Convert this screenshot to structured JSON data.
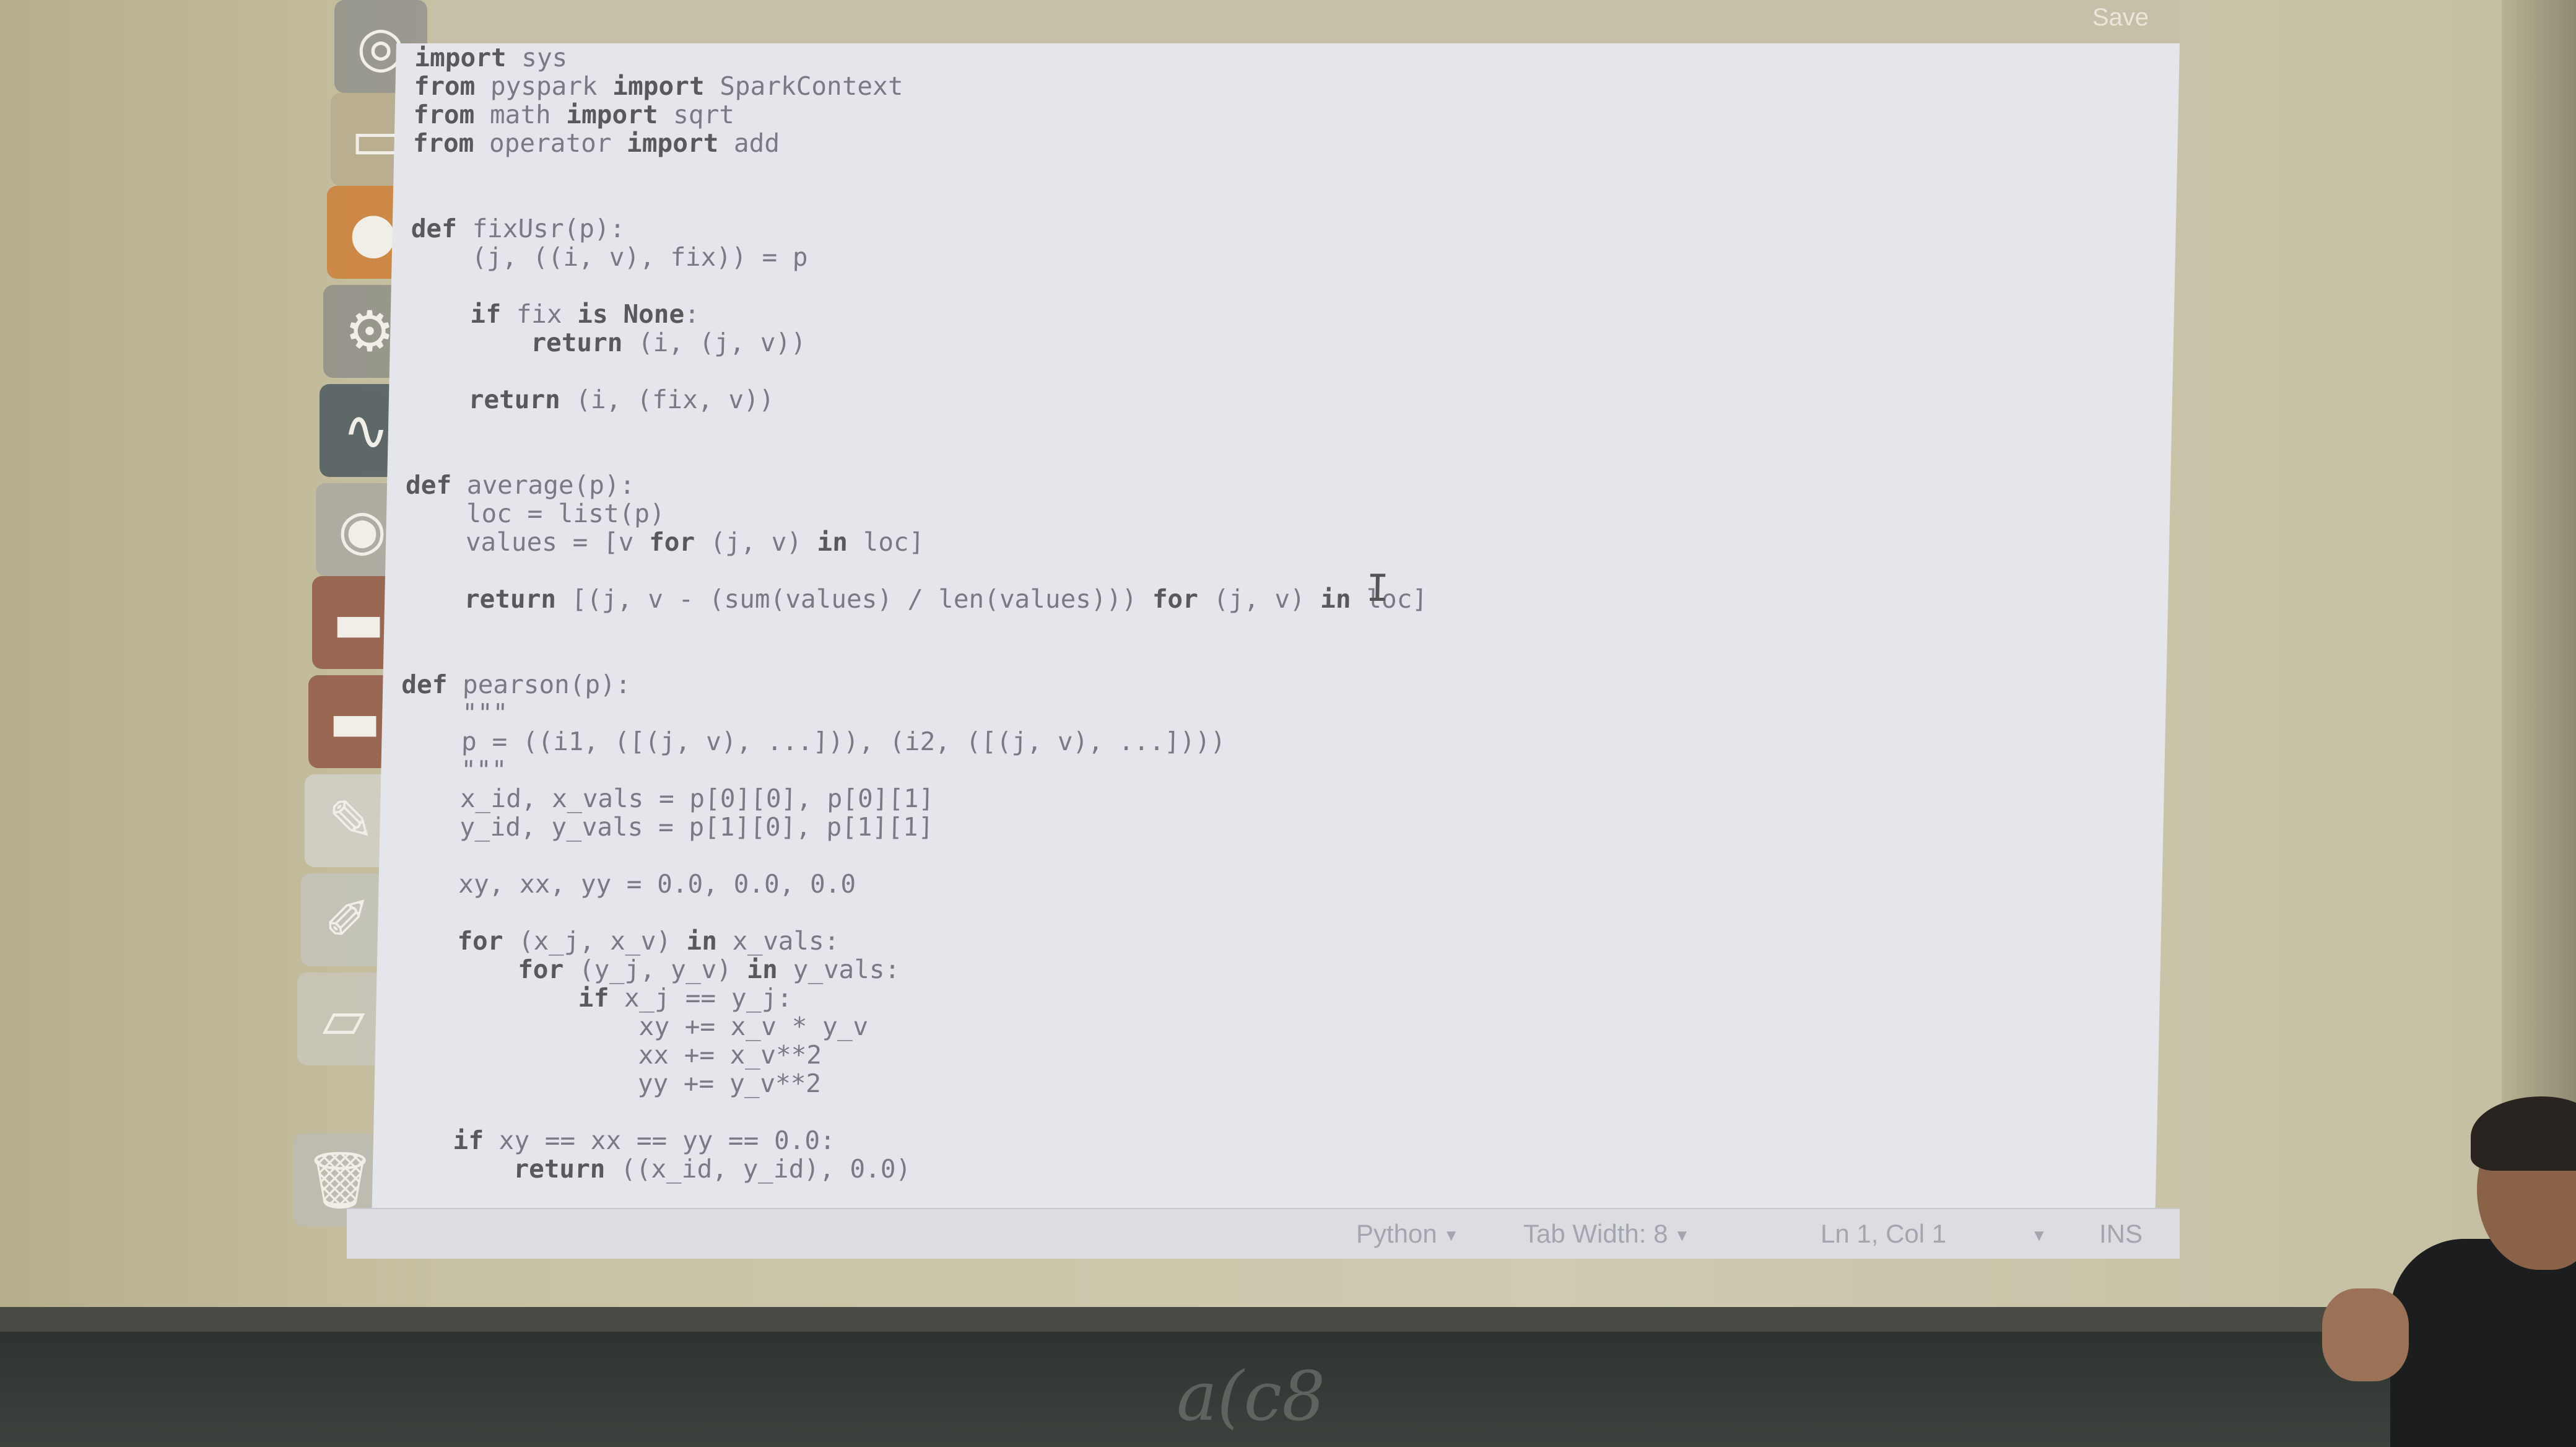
{
  "titlebar": {
    "save_label": "Save"
  },
  "launcher": {
    "items": [
      {
        "icon": "dash-icon",
        "glyph": "◎",
        "color": "#8d8d8a"
      },
      {
        "icon": "files-icon",
        "glyph": "▭",
        "color": "#b7a98d"
      },
      {
        "icon": "firefox-icon",
        "glyph": "●",
        "color": "#d0772b"
      },
      {
        "icon": "settings-icon",
        "glyph": "⚙",
        "color": "#8a8a86"
      },
      {
        "icon": "system-monitor-icon",
        "glyph": "∿",
        "color": "#3d4c57"
      },
      {
        "icon": "chromium-icon",
        "glyph": "◉",
        "color": "#a7a7a2"
      },
      {
        "icon": "terminal-icon",
        "glyph": "▬",
        "color": "#8b4b39"
      },
      {
        "icon": "terminal-2-icon",
        "glyph": "▬",
        "color": "#8b4b39"
      },
      {
        "icon": "inkscape-icon",
        "glyph": "✎",
        "color": "#d4d3cf"
      },
      {
        "icon": "text-editor-icon",
        "glyph": "✐",
        "color": "#c5c5c0"
      },
      {
        "icon": "workspace-icon",
        "glyph": "▱",
        "color": "#c9c7bf"
      },
      {
        "icon": "trash-icon",
        "glyph": "🗑",
        "color": "#bdbcb6"
      }
    ]
  },
  "editor": {
    "code_lines": [
      "import sys",
      "from pyspark import SparkContext",
      "from math import sqrt",
      "from operator import add",
      "",
      "",
      "def fixUsr(p):",
      "    (j, ((i, v), fix)) = p",
      "",
      "    if fix is None:",
      "        return (i, (j, v))",
      "",
      "    return (i, (fix, v))",
      "",
      "",
      "def average(p):",
      "    loc = list(p)",
      "    values = [v for (j, v) in loc]",
      "",
      "    return [(j, v - (sum(values) / len(values))) for (j, v) in loc]",
      "",
      "",
      "def pearson(p):",
      "    \"\"\"",
      "    p = ((i1, ([(j, v), ...])), (i2, ([(j, v), ...])))",
      "    \"\"\"",
      "    x_id, x_vals = p[0][0], p[0][1]",
      "    y_id, y_vals = p[1][0], p[1][1]",
      "",
      "    xy, xx, yy = 0.0, 0.0, 0.0",
      "",
      "    for (x_j, x_v) in x_vals:",
      "        for (y_j, y_v) in y_vals:",
      "            if x_j == y_j:",
      "                xy += x_v * y_v",
      "                xx += x_v**2",
      "                yy += y_v**2",
      "",
      "    if xy == xx == yy == 0.0:",
      "        return ((x_id, y_id), 0.0)"
    ]
  },
  "statusbar": {
    "language": "Python",
    "tab_width": "Tab Width: 8",
    "position": "Ln 1, Col 1",
    "mode": "INS"
  },
  "chalkboard": {
    "scribble": "a(c8"
  }
}
